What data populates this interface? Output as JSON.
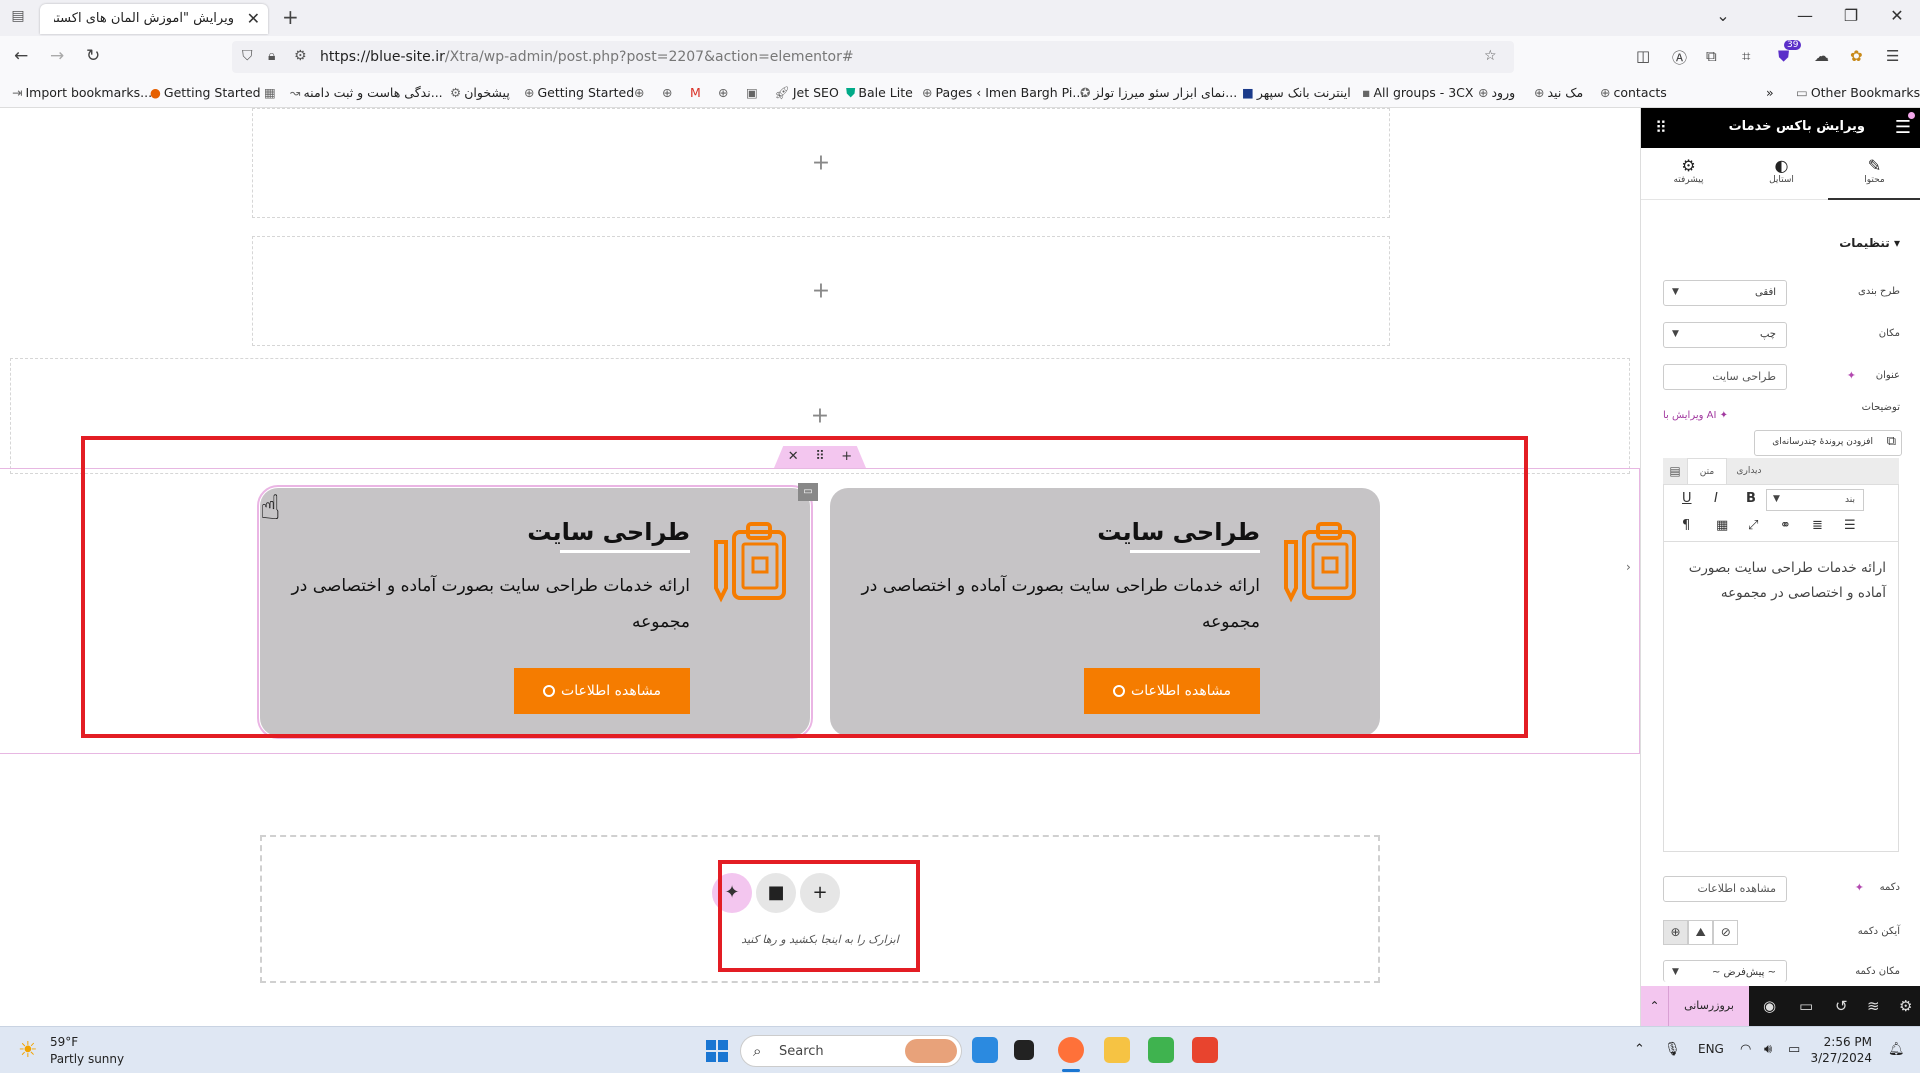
{
  "browser": {
    "tab_title": "ویرایش \"آموزش المان های اکسترا - ع",
    "url_host": "https://blue-site.ir",
    "url_path": "/Xtra/wp-admin/post.php?post=2207&action=elementor#",
    "bookmarks": [
      "Import bookmarks...",
      "Getting Started",
      "ندگی هاست و ثبت دامنه...",
      "پیشخوان",
      "Getting Started",
      "Jet SEO",
      "Bale Lite",
      "Pages ‹ Imen Bargh Pi...",
      "نمای ابزار سئو میرزا تولز...",
      "اینترنت بانک سپهر",
      "All groups - 3CX",
      "ورود",
      "مک نید",
      "contacts"
    ],
    "other_bookmarks": "Other Bookmarks",
    "extension_badge": "39"
  },
  "canvas": {
    "add_symbol": "+",
    "section_handle": [
      "✕",
      "⠿",
      "+"
    ],
    "cards": [
      {
        "title": "طراحی سایت",
        "description": "ارائه خدمات طراحی سایت بصورت آماده و اختصاصی در مجموعه",
        "button": "مشاهده اطلاعات"
      },
      {
        "title": "طراحی سایت",
        "description": "ارائه خدمات طراحی سایت بصورت آماده و اختصاصی در مجموعه",
        "button": "مشاهده اطلاعات"
      }
    ],
    "drop_zone_text": "ابزارک را به اینجا بکشید و رها کنید"
  },
  "panel": {
    "title": "ویرایش باکس خدمات",
    "tabs": [
      "محتوا",
      "استایل",
      "پیشرفته"
    ],
    "section_heading": "تنظیمات",
    "fields": {
      "layout_label": "طرح بندی",
      "layout_value": "افقی",
      "position_label": "مکان",
      "position_value": "چپ",
      "title_label": "عنوان",
      "title_value": "طراحی سایت",
      "description_label": "توضیحات",
      "ai_edit": "ویرایش با AI",
      "add_media": "افزودن پروندهٔ چندرسانه‌ای",
      "editor_tab_visual": "دیداری",
      "editor_tab_text": "متن",
      "paragraph_select": "بند",
      "description_value": "ارائه خدمات طراحی سایت بصورت آماده و اختصاصی در مجموعه",
      "button_label": "دکمه",
      "button_value": "مشاهده اطلاعات",
      "button_icon_label": "آیکن دکمه",
      "button_position_label": "مکان دکمه",
      "button_position_value": "~ پیش‌فرض ~"
    },
    "publish": "بروزرسانی"
  },
  "taskbar": {
    "temperature": "59°F",
    "weather": "Partly sunny",
    "search": "Search",
    "language": "ENG",
    "time": "2:56 PM",
    "date": "3/27/2024"
  },
  "colors": {
    "accent_orange": "#f57c00",
    "card_bg": "#c6c4c6",
    "elementor_pink": "#f3c6ef",
    "highlight_red": "#e31d24"
  }
}
